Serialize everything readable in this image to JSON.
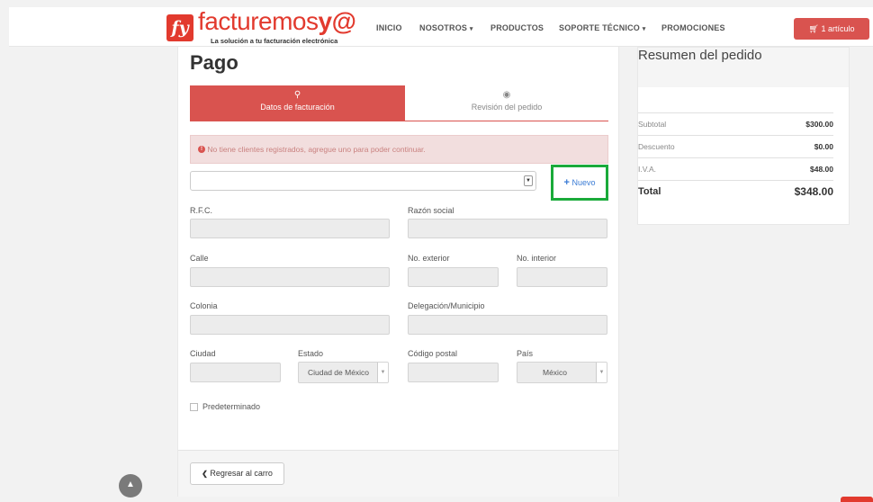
{
  "brand": {
    "logo_badge": "fy",
    "logo_word_a": "facturemos",
    "logo_word_b": "y@",
    "tagline": "La solución a tu facturación electrónica"
  },
  "nav": {
    "items": [
      "INICIO",
      "NOSOTROS",
      "PRODUCTOS",
      "SOPORTE TÉCNICO",
      "PROMOCIONES"
    ],
    "cart_label": "1 artículo"
  },
  "page": {
    "title": "Pago",
    "tabs": [
      {
        "label": "Datos de facturación",
        "icon": "map-pin-icon"
      },
      {
        "label": "Revisión del pedido",
        "icon": "eye-icon"
      }
    ],
    "alert": "No tiene clientes registrados, agregue uno para poder continuar.",
    "client_select_value": "",
    "new_button": "Nuevo"
  },
  "form": {
    "rfc": "R.F.C.",
    "razon_social": "Razón social",
    "calle": "Calle",
    "no_exterior": "No. exterior",
    "no_interior": "No. interior",
    "colonia": "Colonia",
    "delegacion": "Delegación/Municipio",
    "ciudad": "Ciudad",
    "estado": "Estado",
    "estado_value": "Ciudad de México",
    "codigo_postal": "Código postal",
    "pais": "País",
    "pais_value": "México",
    "predeterminado": "Predeterminado"
  },
  "footer": {
    "back_button": "Regresar al carro"
  },
  "summary": {
    "title": "Resumen del pedido",
    "rows": [
      {
        "label": "Subtotal",
        "value": "$300.00"
      },
      {
        "label": "Descuento",
        "value": "$0.00"
      },
      {
        "label": "I.V.A.",
        "value": "$48.00"
      }
    ],
    "total_label": "Total",
    "total_value": "$348.00"
  },
  "colors": {
    "brand_red": "#e23a2e",
    "tab_active": "#d9534f",
    "highlight": "#1aaa3a",
    "link": "#3a7bd5"
  }
}
